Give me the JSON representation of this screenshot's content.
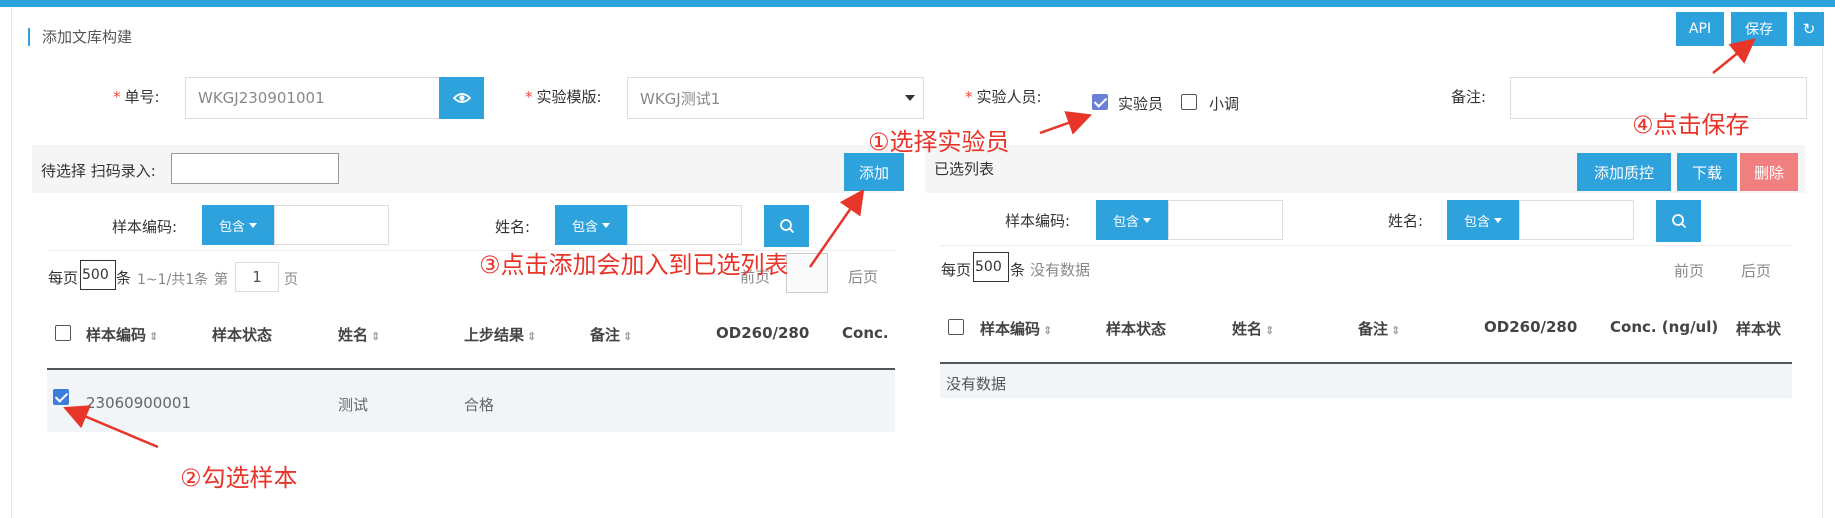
{
  "page": {
    "title": "添加文库构建"
  },
  "toolbar": {
    "api": "API",
    "save": "保存",
    "refresh_icon": "↻"
  },
  "form": {
    "order_no_label": "单号:",
    "order_no_value": "WKGJ230901001",
    "template_label": "实验模版:",
    "template_value": "WKGJ测试1",
    "staff_label": "实验人员:",
    "staff_options": [
      {
        "label": "实验员",
        "checked": true
      },
      {
        "label": "小调",
        "checked": false
      }
    ],
    "note_label": "备注:",
    "note_value": ""
  },
  "left": {
    "header_label": "待选择 扫码录入:",
    "add_button": "添加",
    "sample_code_label": "样本编码:",
    "name_label": "姓名:",
    "contains": "包含",
    "per_page": "每页",
    "per_page_value": "500",
    "per_page_unit": "条",
    "range": "1~1/共1条",
    "page_prefix": "第",
    "page_value": "1",
    "page_suffix": "页",
    "prev": "前页",
    "next": "后页",
    "columns": [
      "样本编码",
      "样本状态",
      "姓名",
      "上步结果",
      "备注",
      "OD260/280",
      "Conc. ("
    ],
    "rows": [
      {
        "code": "23060900001",
        "status": "",
        "name": "测试",
        "result": "合格",
        "note": "",
        "od": "",
        "conc": ""
      }
    ]
  },
  "right": {
    "header_label": "已选列表",
    "add_qc": "添加质控",
    "download": "下载",
    "delete": "删除",
    "sample_code_label": "样本编码:",
    "name_label": "姓名:",
    "contains": "包含",
    "per_page": "每页",
    "per_page_value": "500",
    "per_page_unit": "条",
    "no_data_inline": "没有数据",
    "prev": "前页",
    "next": "后页",
    "columns": [
      "样本编码",
      "样本状态",
      "姓名",
      "备注",
      "OD260/280",
      "Conc. (ng/ul)",
      "样本状"
    ],
    "empty": "没有数据"
  },
  "annotations": {
    "step1": "①选择实验员",
    "step2": "②勾选样本",
    "step3": "③点击添加会加入到已选列表",
    "step4": "④点击保存"
  },
  "colors": {
    "primary": "#2ea2dc",
    "danger": "#f08080",
    "annotation": "#e8352a"
  }
}
